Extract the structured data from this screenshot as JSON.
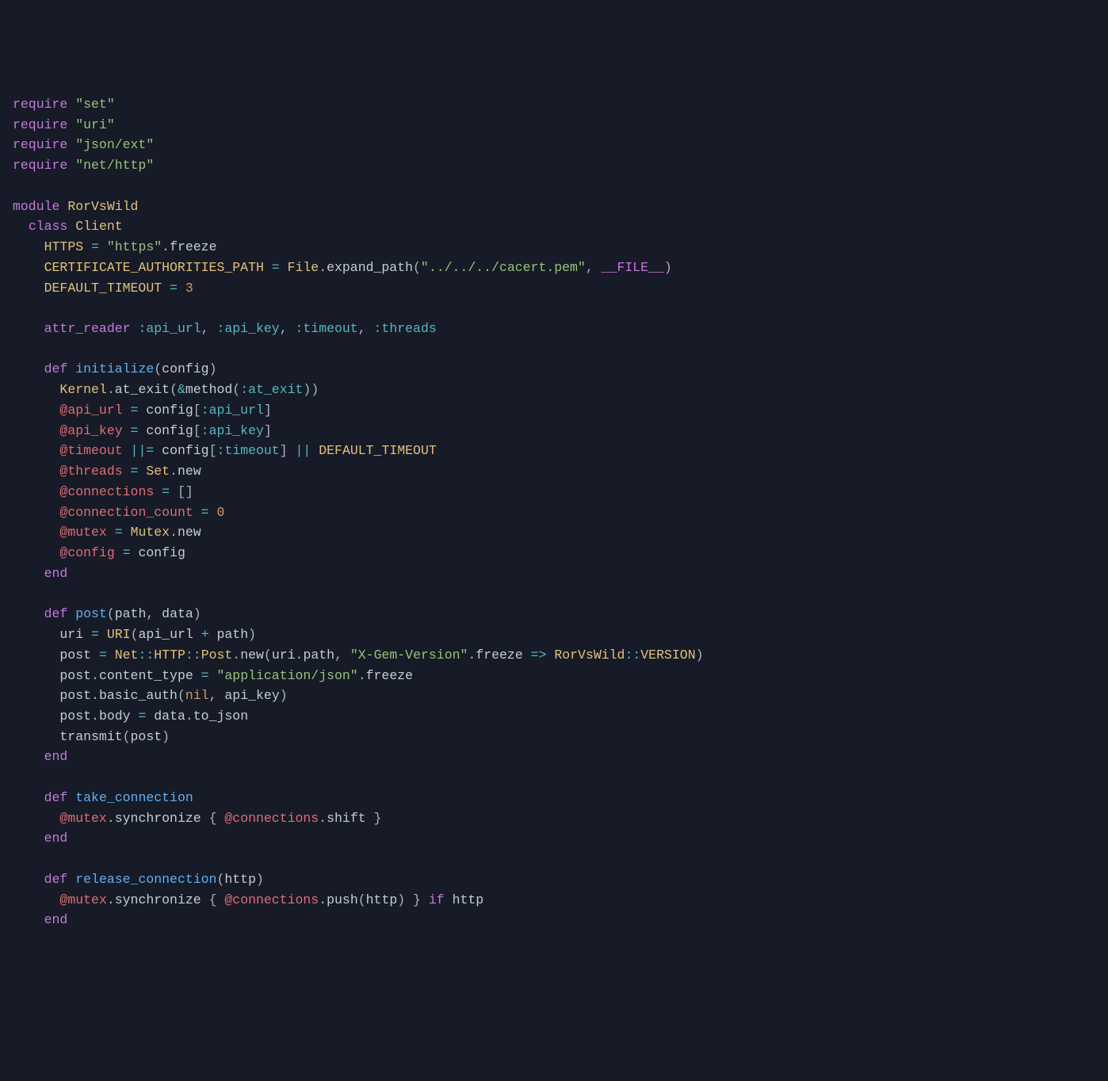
{
  "code": {
    "lines": [
      [
        [
          "kw",
          "require"
        ],
        [
          "id",
          " "
        ],
        [
          "str",
          "\"set\""
        ]
      ],
      [
        [
          "kw",
          "require"
        ],
        [
          "id",
          " "
        ],
        [
          "str",
          "\"uri\""
        ]
      ],
      [
        [
          "kw",
          "require"
        ],
        [
          "id",
          " "
        ],
        [
          "str",
          "\"json/ext\""
        ]
      ],
      [
        [
          "kw",
          "require"
        ],
        [
          "id",
          " "
        ],
        [
          "str",
          "\"net/http\""
        ]
      ],
      [
        [
          "id",
          ""
        ]
      ],
      [
        [
          "kw",
          "module"
        ],
        [
          "id",
          " "
        ],
        [
          "const",
          "RorVsWild"
        ]
      ],
      [
        [
          "id",
          "  "
        ],
        [
          "kw",
          "class"
        ],
        [
          "id",
          " "
        ],
        [
          "const",
          "Client"
        ]
      ],
      [
        [
          "id",
          "    "
        ],
        [
          "const",
          "HTTPS"
        ],
        [
          "id",
          " "
        ],
        [
          "op",
          "="
        ],
        [
          "id",
          " "
        ],
        [
          "str",
          "\"https\""
        ],
        [
          "punc",
          "."
        ],
        [
          "id",
          "freeze"
        ]
      ],
      [
        [
          "id",
          "    "
        ],
        [
          "const",
          "CERTIFICATE_AUTHORITIES_PATH"
        ],
        [
          "id",
          " "
        ],
        [
          "op",
          "="
        ],
        [
          "id",
          " "
        ],
        [
          "const",
          "File"
        ],
        [
          "punc",
          "."
        ],
        [
          "id",
          "expand_path"
        ],
        [
          "punc",
          "("
        ],
        [
          "str",
          "\"../../../cacert.pem\""
        ],
        [
          "punc",
          ", "
        ],
        [
          "kw",
          "__FILE__"
        ],
        [
          "punc",
          ")"
        ]
      ],
      [
        [
          "id",
          "    "
        ],
        [
          "const",
          "DEFAULT_TIMEOUT"
        ],
        [
          "id",
          " "
        ],
        [
          "op",
          "="
        ],
        [
          "id",
          " "
        ],
        [
          "num",
          "3"
        ]
      ],
      [
        [
          "id",
          ""
        ]
      ],
      [
        [
          "id",
          "    "
        ],
        [
          "kw",
          "attr_reader"
        ],
        [
          "id",
          " "
        ],
        [
          "sym",
          ":api_url"
        ],
        [
          "punc",
          ", "
        ],
        [
          "sym",
          ":api_key"
        ],
        [
          "punc",
          ", "
        ],
        [
          "sym",
          ":timeout"
        ],
        [
          "punc",
          ", "
        ],
        [
          "sym",
          ":threads"
        ]
      ],
      [
        [
          "id",
          ""
        ]
      ],
      [
        [
          "id",
          "    "
        ],
        [
          "kw",
          "def"
        ],
        [
          "id",
          " "
        ],
        [
          "fn",
          "initialize"
        ],
        [
          "punc",
          "("
        ],
        [
          "id",
          "config"
        ],
        [
          "punc",
          ")"
        ]
      ],
      [
        [
          "id",
          "      "
        ],
        [
          "const",
          "Kernel"
        ],
        [
          "punc",
          "."
        ],
        [
          "id",
          "at_exit"
        ],
        [
          "punc",
          "("
        ],
        [
          "op",
          "&"
        ],
        [
          "id",
          "method"
        ],
        [
          "punc",
          "("
        ],
        [
          "sym",
          ":at_exit"
        ],
        [
          "punc",
          "))"
        ]
      ],
      [
        [
          "id",
          "      "
        ],
        [
          "ivar",
          "@api_url"
        ],
        [
          "id",
          " "
        ],
        [
          "op",
          "="
        ],
        [
          "id",
          " config"
        ],
        [
          "punc",
          "["
        ],
        [
          "sym",
          ":api_url"
        ],
        [
          "punc",
          "]"
        ]
      ],
      [
        [
          "id",
          "      "
        ],
        [
          "ivar",
          "@api_key"
        ],
        [
          "id",
          " "
        ],
        [
          "op",
          "="
        ],
        [
          "id",
          " config"
        ],
        [
          "punc",
          "["
        ],
        [
          "sym",
          ":api_key"
        ],
        [
          "punc",
          "]"
        ]
      ],
      [
        [
          "id",
          "      "
        ],
        [
          "ivar",
          "@timeout"
        ],
        [
          "id",
          " "
        ],
        [
          "op",
          "||="
        ],
        [
          "id",
          " config"
        ],
        [
          "punc",
          "["
        ],
        [
          "sym",
          ":timeout"
        ],
        [
          "punc",
          "]"
        ],
        [
          "id",
          " "
        ],
        [
          "op",
          "||"
        ],
        [
          "id",
          " "
        ],
        [
          "const",
          "DEFAULT_TIMEOUT"
        ]
      ],
      [
        [
          "id",
          "      "
        ],
        [
          "ivar",
          "@threads"
        ],
        [
          "id",
          " "
        ],
        [
          "op",
          "="
        ],
        [
          "id",
          " "
        ],
        [
          "const",
          "Set"
        ],
        [
          "punc",
          "."
        ],
        [
          "id",
          "new"
        ]
      ],
      [
        [
          "id",
          "      "
        ],
        [
          "ivar",
          "@connections"
        ],
        [
          "id",
          " "
        ],
        [
          "op",
          "="
        ],
        [
          "id",
          " "
        ],
        [
          "punc",
          "[]"
        ]
      ],
      [
        [
          "id",
          "      "
        ],
        [
          "ivar",
          "@connection_count"
        ],
        [
          "id",
          " "
        ],
        [
          "op",
          "="
        ],
        [
          "id",
          " "
        ],
        [
          "num",
          "0"
        ]
      ],
      [
        [
          "id",
          "      "
        ],
        [
          "ivar",
          "@mutex"
        ],
        [
          "id",
          " "
        ],
        [
          "op",
          "="
        ],
        [
          "id",
          " "
        ],
        [
          "const",
          "Mutex"
        ],
        [
          "punc",
          "."
        ],
        [
          "id",
          "new"
        ]
      ],
      [
        [
          "id",
          "      "
        ],
        [
          "ivar",
          "@config"
        ],
        [
          "id",
          " "
        ],
        [
          "op",
          "="
        ],
        [
          "id",
          " config"
        ]
      ],
      [
        [
          "id",
          "    "
        ],
        [
          "kw",
          "end"
        ]
      ],
      [
        [
          "id",
          ""
        ]
      ],
      [
        [
          "id",
          "    "
        ],
        [
          "kw",
          "def"
        ],
        [
          "id",
          " "
        ],
        [
          "fn",
          "post"
        ],
        [
          "punc",
          "("
        ],
        [
          "id",
          "path"
        ],
        [
          "punc",
          ", "
        ],
        [
          "id",
          "data"
        ],
        [
          "punc",
          ")"
        ]
      ],
      [
        [
          "id",
          "      uri "
        ],
        [
          "op",
          "="
        ],
        [
          "id",
          " "
        ],
        [
          "const",
          "URI"
        ],
        [
          "punc",
          "("
        ],
        [
          "id",
          "api_url "
        ],
        [
          "op",
          "+"
        ],
        [
          "id",
          " path"
        ],
        [
          "punc",
          ")"
        ]
      ],
      [
        [
          "id",
          "      post "
        ],
        [
          "op",
          "="
        ],
        [
          "id",
          " "
        ],
        [
          "const",
          "Net"
        ],
        [
          "op",
          "::"
        ],
        [
          "const",
          "HTTP"
        ],
        [
          "op",
          "::"
        ],
        [
          "const",
          "Post"
        ],
        [
          "punc",
          "."
        ],
        [
          "id",
          "new"
        ],
        [
          "punc",
          "("
        ],
        [
          "id",
          "uri"
        ],
        [
          "punc",
          "."
        ],
        [
          "id",
          "path"
        ],
        [
          "punc",
          ", "
        ],
        [
          "str",
          "\"X-Gem-Version\""
        ],
        [
          "punc",
          "."
        ],
        [
          "id",
          "freeze "
        ],
        [
          "op",
          "=>"
        ],
        [
          "id",
          " "
        ],
        [
          "const",
          "RorVsWild"
        ],
        [
          "op",
          "::"
        ],
        [
          "const",
          "VERSION"
        ],
        [
          "punc",
          ")"
        ]
      ],
      [
        [
          "id",
          "      post"
        ],
        [
          "punc",
          "."
        ],
        [
          "id",
          "content_type "
        ],
        [
          "op",
          "="
        ],
        [
          "id",
          " "
        ],
        [
          "str",
          "\"application/json\""
        ],
        [
          "punc",
          "."
        ],
        [
          "id",
          "freeze"
        ]
      ],
      [
        [
          "id",
          "      post"
        ],
        [
          "punc",
          "."
        ],
        [
          "id",
          "basic_auth"
        ],
        [
          "punc",
          "("
        ],
        [
          "nil",
          "nil"
        ],
        [
          "punc",
          ", "
        ],
        [
          "id",
          "api_key"
        ],
        [
          "punc",
          ")"
        ]
      ],
      [
        [
          "id",
          "      post"
        ],
        [
          "punc",
          "."
        ],
        [
          "id",
          "body "
        ],
        [
          "op",
          "="
        ],
        [
          "id",
          " data"
        ],
        [
          "punc",
          "."
        ],
        [
          "id",
          "to_json"
        ]
      ],
      [
        [
          "id",
          "      transmit"
        ],
        [
          "punc",
          "("
        ],
        [
          "id",
          "post"
        ],
        [
          "punc",
          ")"
        ]
      ],
      [
        [
          "id",
          "    "
        ],
        [
          "kw",
          "end"
        ]
      ],
      [
        [
          "id",
          ""
        ]
      ],
      [
        [
          "id",
          "    "
        ],
        [
          "kw",
          "def"
        ],
        [
          "id",
          " "
        ],
        [
          "fn",
          "take_connection"
        ]
      ],
      [
        [
          "id",
          "      "
        ],
        [
          "ivar",
          "@mutex"
        ],
        [
          "punc",
          "."
        ],
        [
          "id",
          "synchronize "
        ],
        [
          "punc",
          "{ "
        ],
        [
          "ivar",
          "@connections"
        ],
        [
          "punc",
          "."
        ],
        [
          "id",
          "shift"
        ],
        [
          "punc",
          " }"
        ]
      ],
      [
        [
          "id",
          "    "
        ],
        [
          "kw",
          "end"
        ]
      ],
      [
        [
          "id",
          ""
        ]
      ],
      [
        [
          "id",
          "    "
        ],
        [
          "kw",
          "def"
        ],
        [
          "id",
          " "
        ],
        [
          "fn",
          "release_connection"
        ],
        [
          "punc",
          "("
        ],
        [
          "id",
          "http"
        ],
        [
          "punc",
          ")"
        ]
      ],
      [
        [
          "id",
          "      "
        ],
        [
          "ivar",
          "@mutex"
        ],
        [
          "punc",
          "."
        ],
        [
          "id",
          "synchronize "
        ],
        [
          "punc",
          "{ "
        ],
        [
          "ivar",
          "@connections"
        ],
        [
          "punc",
          "."
        ],
        [
          "id",
          "push"
        ],
        [
          "punc",
          "("
        ],
        [
          "id",
          "http"
        ],
        [
          "punc",
          ") } "
        ],
        [
          "kw",
          "if"
        ],
        [
          "id",
          " http"
        ]
      ],
      [
        [
          "id",
          "    "
        ],
        [
          "kw",
          "end"
        ]
      ]
    ]
  }
}
